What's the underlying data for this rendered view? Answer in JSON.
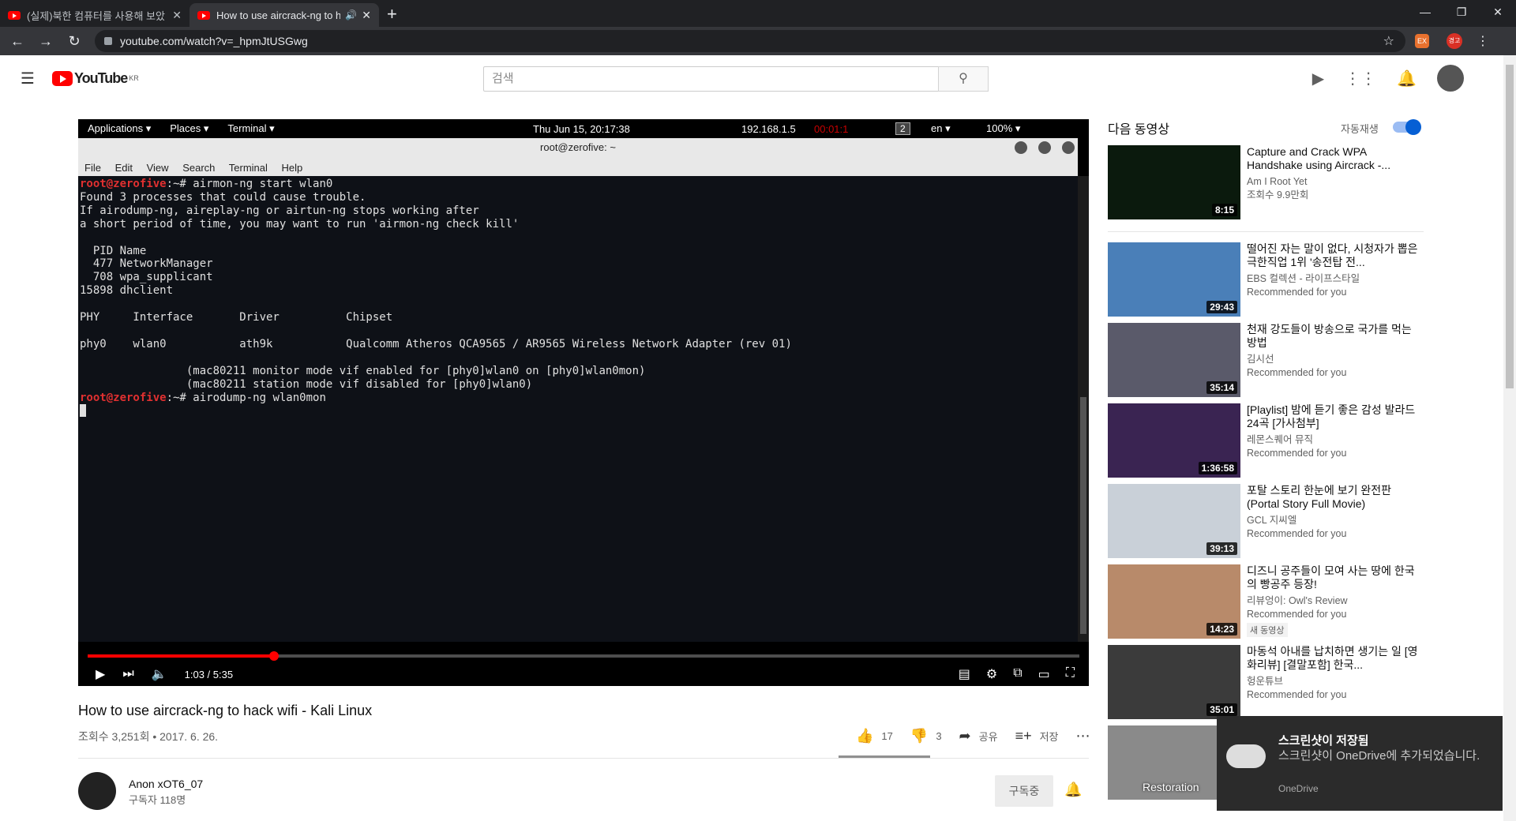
{
  "browser": {
    "tabs": [
      {
        "title": "(실제)북한 컴퓨터를 사용해 보았",
        "close": "✕"
      },
      {
        "title": "How to use aircrack-ng to h",
        "close": "✕"
      }
    ],
    "url": "youtube.com/watch?v=_hpmJtUSGwg",
    "ext_label": "EX",
    "profile_label": "경고"
  },
  "header": {
    "logo": "YouTube",
    "region": "KR",
    "search_placeholder": "검색"
  },
  "player": {
    "kali": {
      "applications": "Applications ▾",
      "places": "Places ▾",
      "terminal": "Terminal ▾",
      "clock": "Thu Jun 15, 20:17:38",
      "ip": "192.168.1.5",
      "rec": "00:01:1",
      "workspace": "2",
      "lang": "en ▾",
      "battery": "100% ▾"
    },
    "terminal": {
      "title": "root@zerofive: ~",
      "menu": [
        "File",
        "Edit",
        "View",
        "Search",
        "Terminal",
        "Help"
      ],
      "prompt": "root@zerofive",
      "cmd1": ":~# airmon-ng start wlan0",
      "output": "\nFound 3 processes that could cause trouble.\nIf airodump-ng, aireplay-ng or airtun-ng stops working after\na short period of time, you may want to run 'airmon-ng check kill'\n\n  PID Name\n  477 NetworkManager\n  708 wpa_supplicant\n15898 dhclient\n\nPHY     Interface       Driver          Chipset\n\nphy0    wlan0           ath9k           Qualcomm Atheros QCA9565 / AR9565 Wireless Network Adapter (rev 01)\n\n                (mac80211 monitor mode vif enabled for [phy0]wlan0 on [phy0]wlan0mon)\n                (mac80211 station mode vif disabled for [phy0]wlan0)\n",
      "cmd2": ":~# airodump-ng wlan0mon"
    },
    "time": "1:03 / 5:35",
    "progress": 0.188
  },
  "video": {
    "title": "How to use aircrack-ng to hack wifi - Kali Linux",
    "meta": "조회수 3,251회 • 2017. 6. 26.",
    "likes": "17",
    "dislikes": "3",
    "share": "공유",
    "save": "저장"
  },
  "channel": {
    "name": "Anon xOT6_07",
    "subs": "구독자 118명",
    "subscribe": "구독중"
  },
  "upnext": {
    "label": "다음 동영상",
    "autoplay": "자동재생",
    "items": [
      {
        "title": "Capture and Crack WPA Handshake using Aircrack -...",
        "channel": "Am I Root Yet",
        "stat": "조회수 9.9만회",
        "duration": "8:15",
        "color": "#0b1a0d"
      },
      {
        "title": "떨어진 자는 말이 없다, 시청자가 뽑은 극한직업 1위 '송전탑 전...",
        "channel": "EBS 컬렉션 - 라이프스타일",
        "stat": "Recommended for you",
        "duration": "29:43",
        "color": "#4a7fb8"
      },
      {
        "title": "천재 강도들이 방송으로 국가를 먹는 방법",
        "channel": "김시선",
        "stat": "Recommended for you",
        "duration": "35:14",
        "color": "#5a5a6a"
      },
      {
        "title": "[Playlist] 밤에 듣기 좋은 감성 발라드 24곡 [가사첨부]",
        "channel": "레몬스퀘어 뮤직",
        "stat": "Recommended for you",
        "duration": "1:36:58",
        "color": "#3a2452"
      },
      {
        "title": "포탈 스토리 한눈에 보기 완전판 (Portal Story Full Movie)",
        "channel": "GCL 지씨엘",
        "stat": "Recommended for you",
        "duration": "39:13",
        "color": "#c9d0d8"
      },
      {
        "title": "디즈니 공주들이 모여 사는 땅에 한국의 빵공주 등장!",
        "channel": "리뷰엉이: Owl's Review",
        "stat": "Recommended for you",
        "duration": "14:23",
        "color": "#b88a6a",
        "badge": "새 동영상"
      },
      {
        "title": "마동석 아내를 납치하면 생기는 일 [영화리뷰] [결말포함] 한국...",
        "channel": "헝운튜브",
        "stat": "Recommended for you",
        "duration": "35:01",
        "color": "#3b3b3b"
      },
      {
        "title": "Restoration",
        "channel": "",
        "stat": "",
        "duration": "",
        "color": "#8a8a8a"
      }
    ]
  },
  "toast": {
    "title": "스크린샷이 저장됨",
    "body": "스크린샷이 OneDrive에 추가되었습니다.",
    "source": "OneDrive"
  }
}
